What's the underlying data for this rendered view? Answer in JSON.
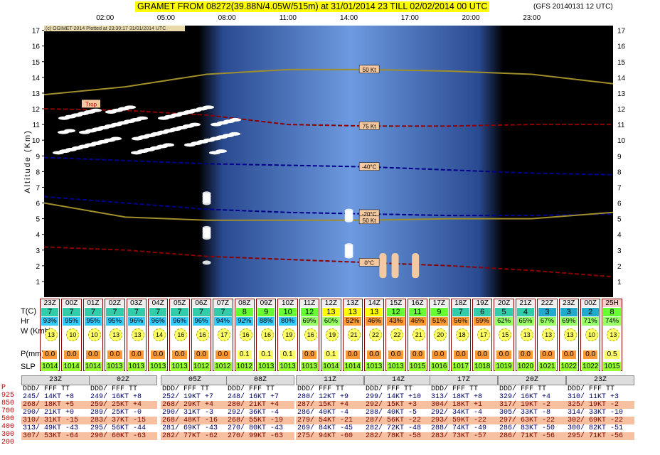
{
  "title": "GRAMET FROM 08272(39.88N/4.05W/515m) at 31/01/2014 23   TILL  02/02/2014 00 UTC",
  "model": "(GFS 20140131 12 UTC)",
  "copyright": "(c) OGIMET-2014 Plotted at 23:30:17 31/01/2014 UTC",
  "colors": {
    "night": "#000000",
    "day": "#4a78c8",
    "surface": "#ff3333",
    "profile": "#fff"
  },
  "chart_data": {
    "type": "area",
    "ylabel": "Altitude (Km)",
    "ylim": [
      0,
      17.3
    ],
    "yticks": [
      "1",
      "2",
      "3",
      "4",
      "5",
      "6",
      "7",
      "8",
      "9",
      "10",
      "11",
      "12",
      "13",
      "14",
      "15",
      "16",
      "17"
    ],
    "xticks": [
      "02:00",
      "05:00",
      "08:00",
      "11:00",
      "14:00",
      "17:00",
      "20:00",
      "23:00"
    ],
    "contours": [
      {
        "label": "50 Kt",
        "x": [
          23,
          27,
          31,
          35,
          39,
          43,
          47,
          51
        ],
        "y": [
          12.9,
          13.4,
          14.2,
          14.5,
          14.5,
          14.4,
          14.2,
          13.6
        ]
      },
      {
        "label": "75 Kt",
        "x": [
          23,
          27,
          31,
          35,
          39,
          43,
          47,
          51
        ],
        "y": [
          12.0,
          11.9,
          11.6,
          11.0,
          10.9,
          10.9,
          11.0,
          11.0
        ]
      },
      {
        "label": "-40°C",
        "x": [
          23,
          27,
          31,
          35,
          39,
          43,
          47,
          51
        ],
        "y": [
          8.9,
          8.7,
          8.5,
          8.4,
          8.3,
          8.1,
          7.9,
          7.8
        ]
      },
      {
        "label": "-20°C",
        "x": [
          23,
          27,
          31,
          35,
          39,
          43,
          47,
          51
        ],
        "y": [
          6.4,
          6.0,
          5.6,
          5.4,
          5.3,
          5.2,
          5.2,
          5.3
        ]
      },
      {
        "label": "50 Kt",
        "x": [
          23,
          27,
          31,
          35,
          39,
          43,
          47,
          51
        ],
        "y": [
          6.0,
          5.1,
          4.9,
          4.9,
          4.9,
          5.0,
          5.0,
          5.4
        ]
      },
      {
        "label": "0°C",
        "x": [
          23,
          27,
          31,
          35,
          39,
          43,
          47,
          51
        ],
        "y": [
          3.2,
          3.0,
          2.6,
          2.4,
          2.2,
          2.0,
          1.7,
          1.3
        ]
      }
    ],
    "trop_label": "Trop"
  },
  "labels": {
    "t": "T(C)",
    "hr": "Hr",
    "w": "W (Kmh)",
    "p": "P(mm)",
    "slp": "SLP"
  },
  "hours": [
    "23Z",
    "00Z",
    "01Z",
    "02Z",
    "03Z",
    "04Z",
    "05Z",
    "06Z",
    "07Z",
    "08Z",
    "09Z",
    "10Z",
    "11Z",
    "12Z",
    "13Z",
    "14Z",
    "15Z",
    "16Z",
    "17Z",
    "18Z",
    "19Z",
    "20Z",
    "21Z",
    "22Z",
    "23Z",
    "00Z",
    "25H"
  ],
  "temps": [
    "7",
    "7",
    "7",
    "7",
    "7",
    "7",
    "7",
    "7",
    "7",
    "8",
    "9",
    "10",
    "12",
    "13",
    "13",
    "13",
    "12",
    "11",
    "9",
    "7",
    "6",
    "5",
    "4",
    "3",
    "3",
    "2",
    "8"
  ],
  "hum": [
    "93%",
    "95%",
    "95%",
    "95%",
    "96%",
    "96%",
    "96%",
    "96%",
    "94%",
    "92%",
    "88%",
    "80%",
    "69%",
    "60%",
    "52%",
    "46%",
    "43%",
    "46%",
    "51%",
    "56%",
    "59%",
    "62%",
    "65%",
    "67%",
    "69%",
    "71%",
    "74%"
  ],
  "wind": [
    "13",
    "10",
    "10",
    "13",
    "13",
    "14",
    "16",
    "16",
    "17",
    "16",
    "16",
    "19",
    "16",
    "19",
    "21",
    "22",
    "22",
    "21",
    "20",
    "18",
    "17",
    "15",
    "13",
    "13",
    "13",
    "10",
    "13"
  ],
  "precip": [
    "0.0",
    "0.0",
    "0.0",
    "0.0",
    "0.0",
    "0.0",
    "0.0",
    "0.0",
    "0.0",
    "0.1",
    "0.1",
    "0.1",
    "0.0",
    "0.1",
    "0.0",
    "0.0",
    "0.0",
    "0.0",
    "0.0",
    "0.0",
    "0.0",
    "0.0",
    "0.0",
    "0.0",
    "0.0",
    "0.0",
    "0.5"
  ],
  "slp": [
    "1014",
    "1014",
    "1014",
    "1013",
    "1013",
    "1013",
    "1013",
    "1012",
    "1012",
    "1012",
    "1013",
    "1013",
    "1013",
    "1014",
    "1014",
    "1013",
    "1013",
    "1015",
    "1016",
    "1017",
    "1018",
    "1019",
    "1020",
    "1021",
    "1022",
    "1022",
    "1015"
  ],
  "pressure_levels": [
    "P",
    "925",
    "850",
    "700",
    "500",
    "400",
    "300",
    "200"
  ],
  "soundings": [
    {
      "time": "23Z",
      "head": "DDD/ FFF TT",
      "rows": [
        "245/ 14KT +8",
        "268/ 18KT +5",
        "290/ 21KT +0",
        "310/ 31KT -15",
        "313/ 49KT -43",
        "307/ 53KT -64"
      ]
    },
    {
      "time": "02Z",
      "head": "DDD/ FFF TT",
      "rows": [
        "249/ 16KT +8",
        "259/ 25KT +4",
        "289/ 25KT -0",
        "283/ 37KT -15",
        "295/ 56KT -44",
        "290/ 60KT -63"
      ]
    },
    {
      "time": "05Z",
      "head": "DDD/ FFF TT",
      "rows": [
        "252/ 19KT +7",
        "268/ 29KT +4",
        "290/ 31KT -3",
        "268/ 48KT -16",
        "281/ 69KT -43",
        "282/ 77KT -62"
      ]
    },
    {
      "time": "08Z",
      "head": "DDD/ FFF TT",
      "rows": [
        "248/ 16KT +7",
        "280/ 21KT +4",
        "292/ 36KT -4",
        "268/ 55KT -19",
        "270/ 80KT -43",
        "270/ 99KT -63"
      ]
    },
    {
      "time": "11Z",
      "head": "DDD/ FFF TT",
      "rows": [
        "280/ 12KT +9",
        "287/ 15KT +4",
        "286/ 40KT -4",
        "279/ 54KT -21",
        "269/ 84KT -45",
        "275/ 94KT -60"
      ]
    },
    {
      "time": "14Z",
      "head": "DDD/ FFF TT",
      "rows": [
        "299/ 14KT +10",
        "292/ 15KT +3",
        "288/ 40KT -5",
        "287/ 56KT -22",
        "282/ 72KT -48",
        "282/ 78KT -58"
      ]
    },
    {
      "time": "17Z",
      "head": "DDD/ FFF TT",
      "rows": [
        "313/ 18KT +8",
        "304/ 18KT +1",
        "292/ 34KT -4",
        "293/ 59KT -22",
        "288/ 74KT -49",
        "283/ 73KT -57"
      ]
    },
    {
      "time": "20Z",
      "head": "DDD/ FFF TT",
      "rows": [
        "329/ 16KT +4",
        "317/ 19KT -2",
        "305/ 33KT -8",
        "297/ 63KT -22",
        "286/ 83KT -50",
        "286/ 71KT -56"
      ]
    },
    {
      "time": "23Z",
      "head": "DDD/ FFF TT",
      "rows": [
        "310/ 11KT +3",
        "325/ 19KT -2",
        "314/ 33KT -10",
        "302/ 69KT -22",
        "300/ 82KT -51",
        "295/ 71KT -56"
      ]
    }
  ]
}
